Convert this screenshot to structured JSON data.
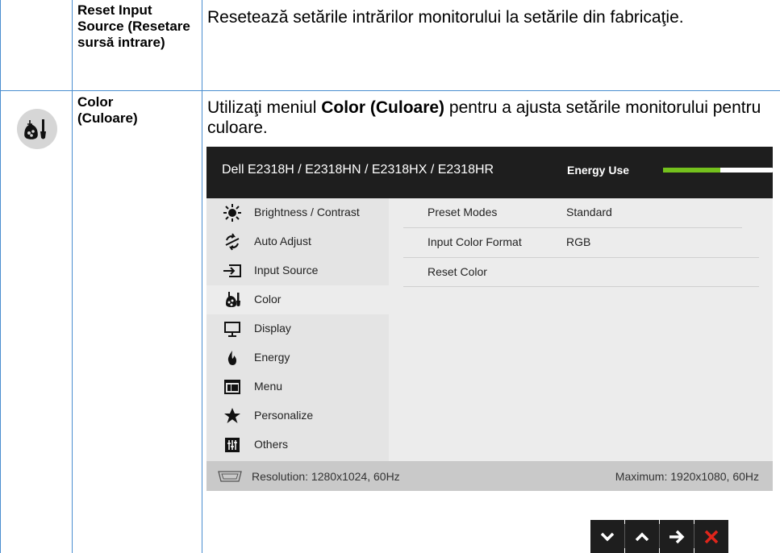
{
  "rows": [
    {
      "label": "Reset Input Source (Resetare sursă intrare)",
      "description": "Resetează setările intrărilor monitorului la setările din fabricaţie."
    },
    {
      "label": "Color (Culoare)",
      "description_before": "Utilizaţi meniul ",
      "description_bold": "Color (Culoare)",
      "description_after": " pentru a ajusta setările monitorului pentru culoare.",
      "icon": "color-palette-icon"
    }
  ],
  "osd": {
    "title": "Dell E2318H / E2318HN / E2318HX / E2318HR",
    "energy_label": "Energy Use",
    "energy_level": 0.52,
    "energy_color": "#74c11d",
    "menu": [
      {
        "label": "Brightness / Contrast",
        "icon": "sun-icon"
      },
      {
        "label": "Auto Adjust",
        "icon": "auto-adjust-icon"
      },
      {
        "label": "Input Source",
        "icon": "input-source-icon"
      },
      {
        "label": "Color",
        "icon": "color-palette-icon",
        "active": true
      },
      {
        "label": "Display",
        "icon": "monitor-icon"
      },
      {
        "label": "Energy",
        "icon": "flame-icon"
      },
      {
        "label": "Menu",
        "icon": "menu-window-icon"
      },
      {
        "label": "Personalize",
        "icon": "star-icon"
      },
      {
        "label": "Others",
        "icon": "sliders-icon"
      }
    ],
    "options": [
      {
        "name": "Preset Modes",
        "value": "Standard"
      },
      {
        "name": "Input Color Format",
        "value": "RGB"
      },
      {
        "name": "Reset Color",
        "value": ""
      }
    ],
    "footer": {
      "resolution": "Resolution: 1280x1024, 60Hz",
      "maximum": "Maximum: 1920x1080, 60Hz"
    }
  },
  "nav_buttons": [
    "down-icon",
    "up-icon",
    "right-arrow-icon",
    "close-icon"
  ],
  "colors": {
    "table_line": "#4a8ed0",
    "close": "#e0251b"
  }
}
